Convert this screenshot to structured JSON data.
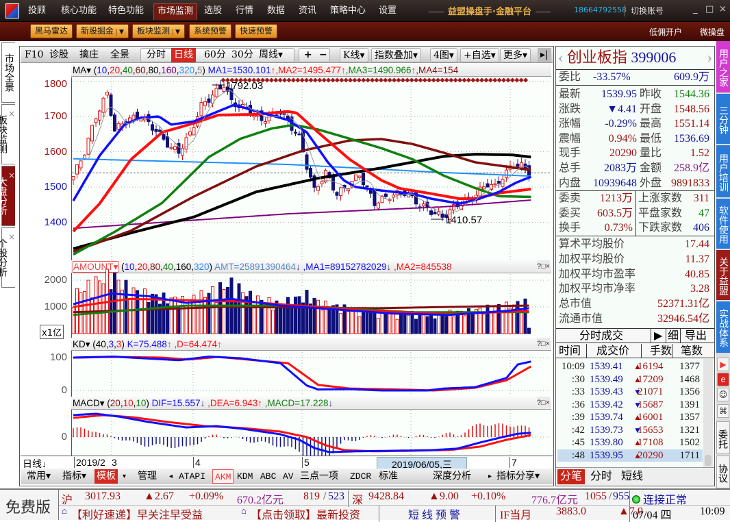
{
  "menu": {
    "items": [
      "投顾",
      "核心功能",
      "特色功能",
      "市场监测",
      "选股",
      "行情",
      "数据",
      "资讯",
      "策略中心",
      "设置"
    ],
    "brand": "益盟操盘手·金融平台",
    "phone": "18664792558",
    "switch_account": "切换账号",
    "controls": [
      "_",
      "□",
      "×"
    ]
  },
  "toolbar": {
    "buttons": [
      "黑马雷达",
      "新股掘金",
      "板块监测",
      "系统预警",
      "快速预警"
    ],
    "right": [
      "低佣开户",
      "微操盘"
    ]
  },
  "left_tabs": [
    "市场全景",
    "板块监测",
    "大盘分析",
    "个股分析"
  ],
  "chart_toolbar": {
    "items": [
      "F10",
      "诊股",
      "擒庄",
      "全景"
    ],
    "periods": [
      "分时",
      "日线",
      "60分",
      "30分",
      "周线▾"
    ],
    "zoom": [
      "+",
      "−"
    ],
    "kline": "K线▾",
    "overlay": "指数叠加▾",
    "layout": "4图▾",
    "watch": "+自选▾",
    "more": "更多▾",
    "end": "▸|"
  },
  "ma_header": {
    "name": "MA▾",
    "params": [
      "10",
      "20",
      "40",
      "60",
      "80",
      "160",
      "320",
      "5"
    ],
    "values": [
      "MA1=1530.101",
      "MA2=1495.477",
      "MA3=1490.966",
      "MA4=154"
    ],
    "arrows": [
      "↑",
      "↑",
      "↑"
    ]
  },
  "amount_header": {
    "name": "AMOUNT▾",
    "params": [
      "10",
      "20",
      "80",
      "40",
      "160",
      "320"
    ],
    "amt": "AMT=25891390464",
    "ma1": "MA1=89152782029",
    "ma2": "MA2=845538",
    "arrow": "↓"
  },
  "kd_header": {
    "name": "KD▾",
    "params": [
      "40",
      "3",
      "3"
    ],
    "k": "K=75.488",
    "d": "D=64.474",
    "arrow": "↑"
  },
  "macd_header": {
    "name": "MACD▾",
    "params": [
      "20",
      "10",
      "10"
    ],
    "dif": "DIF=15.557",
    "dea": "DEA=6.943",
    "macd": "MACD=17.228",
    "up": "↑",
    "down": "↓"
  },
  "panel_controls": "?□×",
  "axes": {
    "price": [
      "1800",
      "1700",
      "1600",
      "1500",
      "1400"
    ],
    "volume": [
      "2000",
      "1000"
    ],
    "volume_unit": "x1亿",
    "kd": [
      "100",
      "0"
    ],
    "macd": [
      "0"
    ]
  },
  "annotations": {
    "high": "1792.03",
    "low": "1410.57"
  },
  "date_axis": {
    "period": "日线↓",
    "labels": [
      "2019/2",
      "3",
      "4",
      "5",
      "7"
    ],
    "cursor": "2019/06/05,三"
  },
  "bottom_tabs": {
    "left": [
      "常用▾",
      "指标▾",
      "模板",
      "▾",
      "管理"
    ],
    "indicators": [
      "◂",
      "ATAPI",
      "AKM",
      "KDM",
      "ABC",
      "AV",
      "三点一项",
      "ZDCR",
      "标准",
      "深度分析",
      "▸"
    ],
    "share": "指标分享▾"
  },
  "colors": {
    "up": "#e01010",
    "down": "#10107a",
    "ma10": "#1010ff",
    "ma20": "#ff1010",
    "ma40": "#108010",
    "ma60": "#801010",
    "ma80": "#000000",
    "ma160": "#800080",
    "ma320": "#2090ff"
  },
  "chart": {
    "close_keypoints": [
      [
        0,
        1530
      ],
      [
        3,
        1600
      ],
      [
        6,
        1700
      ],
      [
        9,
        1765
      ],
      [
        11,
        1660
      ],
      [
        14,
        1690
      ],
      [
        18,
        1700
      ],
      [
        22,
        1660
      ],
      [
        26,
        1610
      ],
      [
        28,
        1600
      ],
      [
        31,
        1650
      ],
      [
        34,
        1730
      ],
      [
        38,
        1770
      ],
      [
        40,
        1792
      ],
      [
        42,
        1740
      ],
      [
        46,
        1720
      ],
      [
        50,
        1690
      ],
      [
        55,
        1715
      ],
      [
        58,
        1670
      ],
      [
        60,
        1640
      ],
      [
        62,
        1560
      ],
      [
        64,
        1490
      ],
      [
        67,
        1540
      ],
      [
        70,
        1480
      ],
      [
        73,
        1505
      ],
      [
        76,
        1535
      ],
      [
        80,
        1455
      ],
      [
        84,
        1475
      ],
      [
        88,
        1485
      ],
      [
        92,
        1450
      ],
      [
        96,
        1425
      ],
      [
        98,
        1415
      ],
      [
        102,
        1450
      ],
      [
        106,
        1470
      ],
      [
        110,
        1510
      ],
      [
        112,
        1500
      ],
      [
        114,
        1530
      ],
      [
        117,
        1565
      ],
      [
        119,
        1560
      ],
      [
        121,
        1540
      ]
    ],
    "ma_series": {
      "ma10": [
        [
          0,
          1461
        ],
        [
          7,
          1589
        ],
        [
          13.6,
          1677
        ],
        [
          17.8,
          1696
        ],
        [
          22.7,
          1700
        ],
        [
          26,
          1677
        ],
        [
          32,
          1686
        ],
        [
          42.7,
          1733
        ],
        [
          48.5,
          1715
        ],
        [
          57,
          1690
        ],
        [
          62,
          1655
        ],
        [
          67.6,
          1570
        ],
        [
          71.8,
          1519
        ],
        [
          75,
          1500
        ],
        [
          81.8,
          1490
        ],
        [
          90,
          1481
        ],
        [
          95,
          1467
        ],
        [
          102.5,
          1453
        ],
        [
          106.7,
          1463
        ],
        [
          113,
          1486
        ],
        [
          117.5,
          1512
        ],
        [
          121.5,
          1529
        ]
      ],
      "ma20": [
        [
          0,
          1374
        ],
        [
          7,
          1453
        ],
        [
          15.3,
          1578
        ],
        [
          23.6,
          1655
        ],
        [
          32,
          1681
        ],
        [
          38.5,
          1704
        ],
        [
          48.5,
          1706
        ],
        [
          57,
          1714
        ],
        [
          59.3,
          1710
        ],
        [
          65,
          1655
        ],
        [
          73.4,
          1578
        ],
        [
          81.8,
          1519
        ],
        [
          86.7,
          1496
        ],
        [
          94,
          1483
        ],
        [
          102.5,
          1467
        ],
        [
          106.7,
          1467
        ],
        [
          113,
          1483
        ],
        [
          121.5,
          1494
        ]
      ],
      "ma40": [
        [
          0,
          1309
        ],
        [
          11,
          1373
        ],
        [
          23.6,
          1455
        ],
        [
          36,
          1585
        ],
        [
          44.4,
          1637
        ],
        [
          52.7,
          1666
        ],
        [
          58.5,
          1676
        ],
        [
          65,
          1663
        ],
        [
          73.4,
          1637
        ],
        [
          81.8,
          1610
        ],
        [
          90,
          1579
        ],
        [
          98.4,
          1532
        ],
        [
          106.7,
          1497
        ],
        [
          113,
          1474
        ],
        [
          121.5,
          1472
        ]
      ],
      "ma60": [
        [
          0,
          1317
        ],
        [
          15.3,
          1376
        ],
        [
          32,
          1473
        ],
        [
          48.5,
          1558
        ],
        [
          60.9,
          1603
        ],
        [
          73.4,
          1632
        ],
        [
          81.8,
          1636
        ],
        [
          90,
          1622
        ],
        [
          98.4,
          1597
        ],
        [
          106.7,
          1570
        ],
        [
          115,
          1558
        ],
        [
          121.5,
          1548
        ]
      ],
      "ma80": [
        [
          0,
          1325
        ],
        [
          15.3,
          1370
        ],
        [
          32,
          1415
        ],
        [
          48.5,
          1486
        ],
        [
          65,
          1525
        ],
        [
          81.8,
          1554
        ],
        [
          98.4,
          1587
        ],
        [
          106.7,
          1593
        ],
        [
          116.5,
          1591
        ],
        [
          121.5,
          1585
        ]
      ],
      "ma160": [
        [
          0,
          1383
        ],
        [
          57,
          1424
        ],
        [
          98.4,
          1444
        ],
        [
          121.5,
          1463
        ]
      ],
      "ma320": [
        [
          0,
          1580
        ],
        [
          57,
          1564
        ],
        [
          98.4,
          1541
        ],
        [
          121.5,
          1531
        ]
      ]
    },
    "current_price": 1539.95,
    "volume_keypoints": [
      [
        0,
        1300
      ],
      [
        5,
        1700
      ],
      [
        10,
        2000
      ],
      [
        15,
        1500
      ],
      [
        20,
        1300
      ],
      [
        30,
        1100
      ],
      [
        38,
        1500
      ],
      [
        42,
        1700
      ],
      [
        48,
        1200
      ],
      [
        55,
        1000
      ],
      [
        62,
        1300
      ],
      [
        66,
        1000
      ],
      [
        75,
        800
      ],
      [
        85,
        700
      ],
      [
        95,
        650
      ],
      [
        105,
        750
      ],
      [
        112,
        900
      ],
      [
        118,
        1000
      ],
      [
        120,
        1050
      ],
      [
        121,
        200
      ]
    ],
    "volume_ma": {
      "ma10": [
        [
          0,
          1100
        ],
        [
          10,
          1500
        ],
        [
          20,
          1400
        ],
        [
          30,
          1150
        ],
        [
          42,
          1300
        ],
        [
          55,
          1050
        ],
        [
          70,
          900
        ],
        [
          85,
          750
        ],
        [
          100,
          700
        ],
        [
          115,
          850
        ],
        [
          121,
          950
        ]
      ],
      "ma20": [
        [
          0,
          1000
        ],
        [
          15,
          1300
        ],
        [
          30,
          1250
        ],
        [
          45,
          1200
        ],
        [
          60,
          1050
        ],
        [
          80,
          850
        ],
        [
          100,
          730
        ],
        [
          121,
          850
        ]
      ],
      "ma40": [
        [
          0,
          700
        ],
        [
          30,
          1050
        ],
        [
          60,
          1050
        ],
        [
          90,
          800
        ],
        [
          121,
          800
        ]
      ],
      "ma80": [
        [
          0,
          800
        ],
        [
          40,
          1000
        ],
        [
          80,
          950
        ],
        [
          121,
          1050
        ]
      ]
    },
    "kd": {
      "k": [
        [
          0,
          100
        ],
        [
          11,
          103
        ],
        [
          15.3,
          100
        ],
        [
          28,
          92
        ],
        [
          36,
          103
        ],
        [
          44.4,
          98
        ],
        [
          55,
          83
        ],
        [
          62,
          15
        ],
        [
          65,
          3
        ],
        [
          73.4,
          4
        ],
        [
          81.8,
          0
        ],
        [
          94,
          0
        ],
        [
          98.4,
          6
        ],
        [
          106.7,
          10
        ],
        [
          115,
          38
        ],
        [
          118,
          79
        ],
        [
          121.5,
          88
        ]
      ],
      "d": [
        [
          0,
          100
        ],
        [
          11,
          102
        ],
        [
          23.6,
          100
        ],
        [
          30.4,
          94
        ],
        [
          38.5,
          102
        ],
        [
          57,
          83
        ],
        [
          65,
          17
        ],
        [
          73.4,
          6
        ],
        [
          90,
          2
        ],
        [
          95.8,
          0
        ],
        [
          106.7,
          8
        ],
        [
          115,
          31
        ],
        [
          121.5,
          73
        ]
      ]
    },
    "macd": {
      "dif": [
        [
          0,
          80
        ],
        [
          6,
          85
        ],
        [
          12,
          75
        ],
        [
          20,
          55
        ],
        [
          30,
          35
        ],
        [
          38,
          40
        ],
        [
          45,
          30
        ],
        [
          55,
          10
        ],
        [
          60,
          -10
        ],
        [
          64,
          -40
        ],
        [
          68,
          -55
        ],
        [
          75,
          -52
        ],
        [
          85,
          -50
        ],
        [
          95,
          -48
        ],
        [
          102,
          -42
        ],
        [
          108,
          -20
        ],
        [
          114,
          0
        ],
        [
          118,
          12
        ],
        [
          121.5,
          15.6
        ]
      ],
      "dea": [
        [
          0,
          70
        ],
        [
          8,
          80
        ],
        [
          16,
          72
        ],
        [
          25,
          55
        ],
        [
          35,
          40
        ],
        [
          45,
          33
        ],
        [
          55,
          20
        ],
        [
          62,
          0
        ],
        [
          67,
          -30
        ],
        [
          72,
          -48
        ],
        [
          80,
          -52
        ],
        [
          90,
          -50
        ],
        [
          100,
          -47
        ],
        [
          108,
          -35
        ],
        [
          115,
          -10
        ],
        [
          121.5,
          7
        ]
      ]
    }
  },
  "quote": {
    "name": "创业板指",
    "code": "399006",
    "weibi_label": "委比",
    "weibi": "-33.57%",
    "weicha": "609.9万",
    "rows": [
      [
        "最新",
        "1539.95",
        "昨收",
        "1544.36"
      ],
      [
        "涨跌",
        "▼4.41",
        "开盘",
        "1548.56"
      ],
      [
        "涨幅",
        "-0.29%",
        "最高",
        "1551.14"
      ],
      [
        "震幅",
        "0.94%",
        "最低",
        "1536.69"
      ],
      [
        "现手",
        "20290",
        "量比",
        "1.52"
      ],
      [
        "总手",
        "2083万",
        "金额",
        "258.9亿"
      ],
      [
        "内盘",
        "10939648",
        "外盘",
        "9891833"
      ]
    ],
    "orders": [
      [
        "委卖",
        "1213万",
        "上涨家数",
        "311"
      ],
      [
        "委买",
        "603.5万",
        "平盘家数",
        "47"
      ],
      [
        "换手",
        "0.73%",
        "下跌家数",
        "406"
      ]
    ],
    "stats": [
      [
        "算术平均股价",
        "17.44"
      ],
      [
        "加权平均股价",
        "11.37"
      ],
      [
        "加权平均市盈率",
        "40.85"
      ],
      [
        "加权平均市净率",
        "3.28"
      ],
      [
        "总市值",
        "52371.31亿"
      ],
      [
        "流通市值",
        "32946.54亿"
      ]
    ]
  },
  "ticks": {
    "title": "分时成交",
    "detail": "细",
    "export": "导出",
    "columns": [
      "时间",
      "成交价",
      "手数",
      "笔数"
    ],
    "rows": [
      [
        "10:09",
        "1539.41",
        "▲",
        "16194",
        "1377"
      ],
      [
        ":30",
        "1539.49",
        "▲",
        "17209",
        "1468"
      ],
      [
        ":33",
        "1539.43",
        "▼",
        "21071",
        "1356"
      ],
      [
        ":36",
        "1539.42",
        "▼",
        "15687",
        "1391"
      ],
      [
        ":39",
        "1539.74",
        "▲",
        "16001",
        "1357"
      ],
      [
        ":42",
        "1539.73",
        "▼",
        "15653",
        "1321"
      ],
      [
        ":45",
        "1539.80",
        "▲",
        "17108",
        "1502"
      ],
      [
        ":48",
        "1539.95",
        "▲",
        "20290",
        "1711"
      ]
    ],
    "tabs": [
      "分笔",
      "分时",
      "短线"
    ]
  },
  "right_strip": {
    "tabs": [
      "用户之家",
      "三分钟",
      "用户培训",
      "软件使用",
      "关于益盟",
      "实战体系"
    ],
    "entrust": "委托",
    "agreement": "协议"
  },
  "status": {
    "edition": "免费版",
    "sh": {
      "name": "沪",
      "index": "3017.93",
      "change": "▲2.67",
      "pct": "+0.09%",
      "amount": "670.2亿元",
      "up": "819",
      "down": "523"
    },
    "sz": {
      "name": "深",
      "index": "9428.84",
      "change": "▲9.00",
      "pct": "+0.10%",
      "amount": "776.7亿元",
      "up": "1055",
      "down": "955"
    },
    "connection": "连接正常",
    "news1": "【利好速递】早关注早受益",
    "news2": "【点击领取】最新投资",
    "alert": "短 线 预 警",
    "if_name": "IF当月",
    "if_price": "3883.0",
    "if_change": "▲7.0",
    "date": "07/04 四",
    "time": "10:09"
  }
}
